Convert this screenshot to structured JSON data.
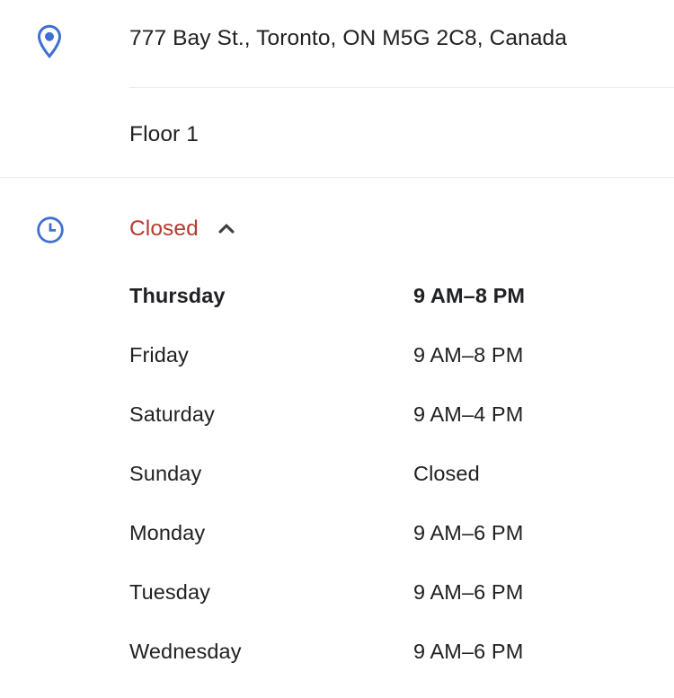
{
  "address": {
    "icon": "location-pin-icon",
    "text": "777 Bay St., Toronto, ON M5G 2C8, Canada",
    "floor": "Floor 1"
  },
  "hours": {
    "icon": "clock-icon",
    "status": "Closed",
    "status_color": "#b53a30",
    "toggle_icon": "chevron-up-icon",
    "expanded": true,
    "rows": [
      {
        "day": "Thursday",
        "time": "9 AM–8 PM",
        "today": true
      },
      {
        "day": "Friday",
        "time": "9 AM–8 PM",
        "today": false
      },
      {
        "day": "Saturday",
        "time": "9 AM–4 PM",
        "today": false
      },
      {
        "day": "Sunday",
        "time": "Closed",
        "today": false
      },
      {
        "day": "Monday",
        "time": "9 AM–6 PM",
        "today": false
      },
      {
        "day": "Tuesday",
        "time": "9 AM–6 PM",
        "today": false
      },
      {
        "day": "Wednesday",
        "time": "9 AM–6 PM",
        "today": false
      }
    ]
  },
  "theme": {
    "icon_blue": "#3f6fd1",
    "text_primary": "#202124",
    "divider": "#e8eaed",
    "background": "#ffffff"
  }
}
